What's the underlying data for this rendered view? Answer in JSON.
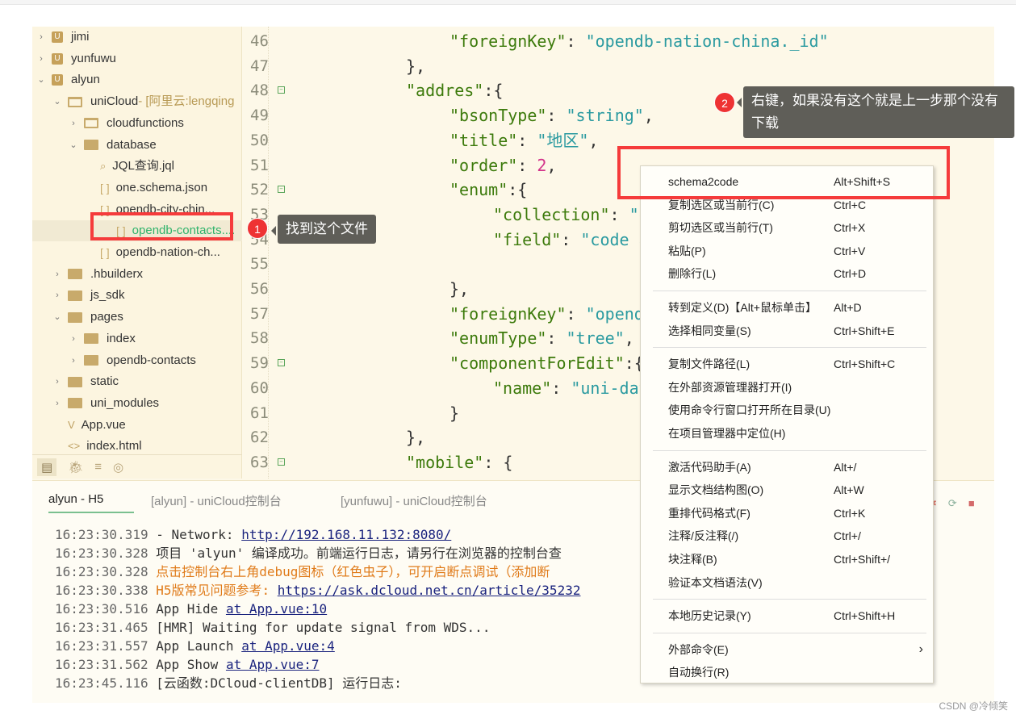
{
  "sidebar": {
    "items": [
      {
        "label": "jimi",
        "type": "project",
        "expanded": false,
        "depth": 0
      },
      {
        "label": "yunfuwu",
        "type": "project",
        "expanded": false,
        "depth": 0
      },
      {
        "label": "alyun",
        "type": "project",
        "expanded": true,
        "depth": 0
      },
      {
        "label": "uniCloud",
        "suffix": " - [阿里云:lengqing",
        "type": "folder-open",
        "expanded": true,
        "depth": 1
      },
      {
        "label": "cloudfunctions",
        "type": "folder-open",
        "expanded": false,
        "depth": 2
      },
      {
        "label": "database",
        "type": "folder",
        "expanded": true,
        "depth": 2
      },
      {
        "label": "JQL查询.jql",
        "type": "jql",
        "depth": 3
      },
      {
        "label": "one.schema.json",
        "type": "json",
        "depth": 3
      },
      {
        "label": "opendb-city-chin...",
        "type": "json",
        "depth": 3
      },
      {
        "label": "opendb-contacts....",
        "type": "json",
        "depth": 3,
        "selected": true
      },
      {
        "label": "opendb-nation-ch...",
        "type": "json",
        "depth": 3
      },
      {
        "label": ".hbuilderx",
        "type": "folder",
        "expanded": false,
        "depth": 1
      },
      {
        "label": "js_sdk",
        "type": "folder",
        "expanded": false,
        "depth": 1
      },
      {
        "label": "pages",
        "type": "folder",
        "expanded": true,
        "depth": 1
      },
      {
        "label": "index",
        "type": "folder",
        "expanded": false,
        "depth": 2
      },
      {
        "label": "opendb-contacts",
        "type": "folder",
        "expanded": false,
        "depth": 2
      },
      {
        "label": "static",
        "type": "folder",
        "expanded": false,
        "depth": 1
      },
      {
        "label": "uni_modules",
        "type": "folder",
        "expanded": false,
        "depth": 1
      },
      {
        "label": "App.vue",
        "type": "vue",
        "depth": 1
      },
      {
        "label": "index.html",
        "type": "html",
        "depth": 1
      }
    ],
    "bottom_tabs": [
      "project-icon",
      "debug-icon",
      "search-icon",
      "web-icon"
    ]
  },
  "editor": {
    "lines": [
      {
        "n": "46",
        "indent": 3,
        "tokens": [
          [
            "k",
            "\"foreignKey\""
          ],
          [
            "p",
            ": "
          ],
          [
            "s",
            "\"opendb-nation-china._id\""
          ]
        ]
      },
      {
        "n": "47",
        "indent": 2,
        "tokens": [
          [
            "p",
            "},"
          ]
        ]
      },
      {
        "n": "48",
        "indent": 2,
        "fold": true,
        "tokens": [
          [
            "k",
            "\"addres\""
          ],
          [
            "p",
            ":{"
          ]
        ]
      },
      {
        "n": "49",
        "indent": 3,
        "tokens": [
          [
            "k",
            "\"bsonType\""
          ],
          [
            "p",
            ": "
          ],
          [
            "s",
            "\"string\""
          ],
          [
            "p",
            ","
          ]
        ]
      },
      {
        "n": "50",
        "indent": 3,
        "tokens": [
          [
            "k",
            "\"title\""
          ],
          [
            "p",
            ": "
          ],
          [
            "s",
            "\"地区\""
          ],
          [
            "p",
            ","
          ]
        ]
      },
      {
        "n": "51",
        "indent": 3,
        "tokens": [
          [
            "k",
            "\"order\""
          ],
          [
            "p",
            ": "
          ],
          [
            "n",
            "2"
          ],
          [
            "p",
            ","
          ]
        ]
      },
      {
        "n": "52",
        "indent": 3,
        "fold": true,
        "tokens": [
          [
            "k",
            "\"enum\""
          ],
          [
            "p",
            ":{"
          ]
        ]
      },
      {
        "n": "53",
        "indent": 4,
        "tokens": [
          [
            "k",
            "\"collection\""
          ],
          [
            "p",
            ": "
          ],
          [
            "s",
            "\"op"
          ]
        ]
      },
      {
        "n": "54",
        "indent": 4,
        "tokens": [
          [
            "k",
            "\"field\""
          ],
          [
            "p",
            ": "
          ],
          [
            "s",
            "\"code as"
          ]
        ]
      },
      {
        "n": "55",
        "indent": 0,
        "tokens": []
      },
      {
        "n": "56",
        "indent": 3,
        "tokens": [
          [
            "p",
            "},"
          ]
        ]
      },
      {
        "n": "57",
        "indent": 3,
        "tokens": [
          [
            "k",
            "\"foreignKey\""
          ],
          [
            "p",
            ": "
          ],
          [
            "s",
            "\"opendb"
          ]
        ]
      },
      {
        "n": "58",
        "indent": 3,
        "tokens": [
          [
            "k",
            "\"enumType\""
          ],
          [
            "p",
            ": "
          ],
          [
            "s",
            "\"tree\""
          ],
          [
            "p",
            ","
          ]
        ]
      },
      {
        "n": "59",
        "indent": 3,
        "fold": true,
        "tokens": [
          [
            "k",
            "\"componentForEdit\""
          ],
          [
            "p",
            ":{"
          ]
        ]
      },
      {
        "n": "60",
        "indent": 4,
        "tokens": [
          [
            "k",
            "\"name\""
          ],
          [
            "p",
            ": "
          ],
          [
            "s",
            "\"uni-data"
          ]
        ]
      },
      {
        "n": "61",
        "indent": 3,
        "tokens": [
          [
            "p",
            "}"
          ]
        ]
      },
      {
        "n": "62",
        "indent": 2,
        "tokens": [
          [
            "p",
            "},"
          ]
        ]
      },
      {
        "n": "63",
        "indent": 2,
        "fold": true,
        "tokens": [
          [
            "k",
            "\"mobile\""
          ],
          [
            "p",
            ": {"
          ]
        ]
      }
    ]
  },
  "console": {
    "tabs": [
      "alyun - H5",
      "[alyun] - uniCloud控制台",
      "[yunfuwu] - uniCloud控制台"
    ],
    "logs": [
      {
        "time": "16:23:30.319",
        "text": "  - Network: ",
        "link": "http://192.168.11.132:8080/",
        "style": "normal"
      },
      {
        "time": "16:23:30.328",
        "text": "项目 'alyun' 编译成功。前端运行日志，请另行在浏览器的控制台查",
        "style": "normal"
      },
      {
        "time": "16:23:30.328",
        "text": "点击控制台右上角debug图标（红色虫子），可开启断点调试（添加断",
        "style": "orange"
      },
      {
        "time": "16:23:30.338",
        "text": "H5版常见问题参考: ",
        "link": "https://ask.dcloud.net.cn/article/35232",
        "style": "orange"
      },
      {
        "time": "16:23:30.516",
        "text": "App Hide  ",
        "link": "at App.vue:10",
        "style": "normal"
      },
      {
        "time": "16:23:31.465",
        "text": "[HMR] Waiting for update signal from WDS...",
        "style": "normal"
      },
      {
        "time": "16:23:31.557",
        "text": "App Launch  ",
        "link": "at App.vue:4",
        "style": "normal"
      },
      {
        "time": "16:23:31.562",
        "text": "App Show  ",
        "link": "at App.vue:7",
        "style": "normal"
      },
      {
        "time": "16:23:45.116",
        "text": "[云函数:DCloud-clientDB] 运行日志:",
        "style": "normal"
      }
    ]
  },
  "context_menu": {
    "groups": [
      [
        {
          "label": "schema2code",
          "shortcut": "Alt+Shift+S"
        },
        {
          "label": "复制选区或当前行(C)",
          "shortcut": "Ctrl+C"
        },
        {
          "label": "剪切选区或当前行(T)",
          "shortcut": "Ctrl+X"
        },
        {
          "label": "粘贴(P)",
          "shortcut": "Ctrl+V"
        },
        {
          "label": "删除行(L)",
          "shortcut": "Ctrl+D"
        }
      ],
      [
        {
          "label": "转到定义(D)【Alt+鼠标单击】",
          "shortcut": "Alt+D"
        },
        {
          "label": "选择相同变量(S)",
          "shortcut": "Ctrl+Shift+E"
        }
      ],
      [
        {
          "label": "复制文件路径(L)",
          "shortcut": "Ctrl+Shift+C"
        },
        {
          "label": "在外部资源管理器打开(I)",
          "shortcut": ""
        },
        {
          "label": "使用命令行窗口打开所在目录(U)",
          "shortcut": ""
        },
        {
          "label": "在项目管理器中定位(H)",
          "shortcut": ""
        }
      ],
      [
        {
          "label": "激活代码助手(A)",
          "shortcut": "Alt+/"
        },
        {
          "label": "显示文档结构图(O)",
          "shortcut": "Alt+W"
        },
        {
          "label": "重排代码格式(F)",
          "shortcut": "Ctrl+K"
        },
        {
          "label": "注释/反注释(/)",
          "shortcut": "Ctrl+/"
        },
        {
          "label": "块注释(B)",
          "shortcut": "Ctrl+Shift+/"
        },
        {
          "label": "验证本文档语法(V)",
          "shortcut": ""
        }
      ],
      [
        {
          "label": "本地历史记录(Y)",
          "shortcut": "Ctrl+Shift+H"
        }
      ],
      [
        {
          "label": "外部命令(E)",
          "shortcut": "",
          "submenu": true
        },
        {
          "label": "自动换行(R)",
          "shortcut": ""
        }
      ]
    ]
  },
  "annotations": [
    {
      "badge": "1",
      "text": "找到这个文件"
    },
    {
      "badge": "2",
      "text": "右键，如果没有这个就是上一步那个没有下载"
    }
  ],
  "watermark": "CSDN @冷倾笑",
  "colors": {
    "highlight": "#f53b3b",
    "key": "#3c7a0b",
    "string": "#2a9aa0",
    "number": "#d3338a",
    "log_orange": "#e07b1a",
    "selected_file": "#2fb36b"
  }
}
